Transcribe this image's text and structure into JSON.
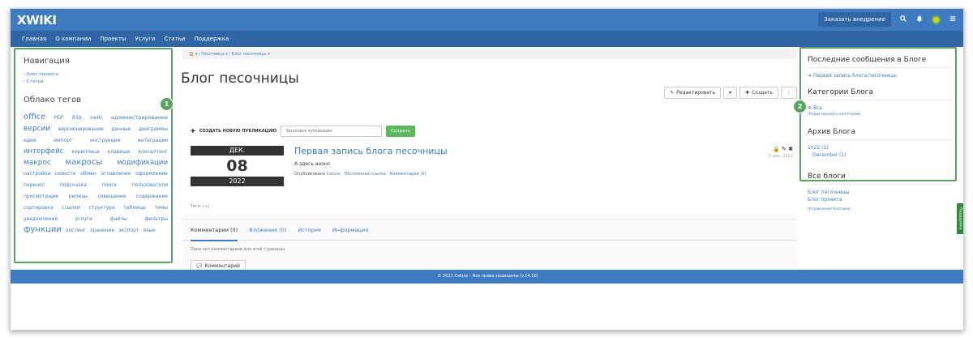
{
  "topbar": {
    "logo": "XWIKI",
    "order_button": "Заказать внедрение",
    "search_icon": "search-icon",
    "bell_icon": "bell-icon",
    "menu_icon": "menu-icon"
  },
  "menu": [
    "Главная",
    "О компании",
    "Проекты",
    "Услуги",
    "Статьи",
    "Поддержка"
  ],
  "left": {
    "nav_title": "Навигация",
    "nav_links": [
      "› Блог проекта",
      "› Статьи"
    ],
    "tags_title": "Облако тегов",
    "tags": [
      {
        "t": "office",
        "s": 10
      },
      {
        "t": "PDF",
        "s": 6
      },
      {
        "t": "RSS",
        "s": 6
      },
      {
        "t": "xwiki",
        "s": 6
      },
      {
        "t": "администрирование",
        "s": 6.5
      },
      {
        "t": "версии",
        "s": 9
      },
      {
        "t": "версионирование",
        "s": 6
      },
      {
        "t": "данные",
        "s": 6
      },
      {
        "t": "диаграммы",
        "s": 6
      },
      {
        "t": "идеи",
        "s": 6
      },
      {
        "t": "импорт",
        "s": 6
      },
      {
        "t": "инструкция",
        "s": 6
      },
      {
        "t": "интеграция",
        "s": 6
      },
      {
        "t": "интерфейс",
        "s": 8.5
      },
      {
        "t": "кириллица",
        "s": 6
      },
      {
        "t": "клавиши",
        "s": 6
      },
      {
        "t": "консалтинг",
        "s": 6
      },
      {
        "t": "макрос",
        "s": 9
      },
      {
        "t": "макросы",
        "s": 10
      },
      {
        "t": "модификации",
        "s": 8.5
      },
      {
        "t": "настройки",
        "s": 6
      },
      {
        "t": "новости",
        "s": 6
      },
      {
        "t": "обмен",
        "s": 6
      },
      {
        "t": "оглавление",
        "s": 6
      },
      {
        "t": "оформление",
        "s": 6
      },
      {
        "t": "перенос",
        "s": 6
      },
      {
        "t": "подсказка",
        "s": 6
      },
      {
        "t": "поиск",
        "s": 6
      },
      {
        "t": "пользователи",
        "s": 6
      },
      {
        "t": "просмотрщик",
        "s": 6
      },
      {
        "t": "релизы",
        "s": 6
      },
      {
        "t": "совещание",
        "s": 6
      },
      {
        "t": "содержание",
        "s": 6
      },
      {
        "t": "сортировка",
        "s": 6
      },
      {
        "t": "ссылки",
        "s": 6
      },
      {
        "t": "структура",
        "s": 6
      },
      {
        "t": "таблицы",
        "s": 6
      },
      {
        "t": "темы",
        "s": 6
      },
      {
        "t": "уведомления",
        "s": 6
      },
      {
        "t": "услуги",
        "s": 6
      },
      {
        "t": "файлы",
        "s": 6
      },
      {
        "t": "фильтры",
        "s": 6
      },
      {
        "t": "функции",
        "s": 10
      },
      {
        "t": "хостинг",
        "s": 6
      },
      {
        "t": "хранение",
        "s": 6
      },
      {
        "t": "экспорт",
        "s": 6
      },
      {
        "t": "язык",
        "s": 6
      }
    ]
  },
  "main": {
    "breadcrumb": "🏠 ▾ / Песочница ▾ / Блог песочницы ▾",
    "title": "Блог песочницы",
    "edit_label": "Редактировать",
    "create_label": "Создать",
    "new_post_label": "СОЗДАТЬ НОВУЮ ПУБЛИКАЦИЮ",
    "new_post_placeholder": "Заголовок публикации",
    "new_post_button": "Создать",
    "post": {
      "month": "ДЕК.",
      "day": "08",
      "year": "2022",
      "title": "Первая запись блога песочницы",
      "text": "А здесь анонс",
      "meta_prefix": "Опубликовано",
      "meta_author": "Coluns",
      "meta_sep1": " · ",
      "meta_link": "Постоянная ссылка",
      "meta_sep2": " · ",
      "meta_comments": "Комментарии (0)",
      "date": "8 дек. 2022"
    },
    "tags_label": "Теги: [+]",
    "tabs": [
      "Комментарии (0)",
      "Вложения (0)",
      "История",
      "Информация"
    ],
    "no_comments": "Пока нет комментариев для этой страницы",
    "comment_button": "Комментарий"
  },
  "right": {
    "recent_title": "Последние сообщения в Блоге",
    "recent_link": "Первая запись блога песочницы",
    "categories_title": "Категории Блога",
    "categories_all": "Все",
    "categories_edit": "(Редактировать категории)",
    "archive_title": "Архив Блога",
    "archive_year": "2022 (1)",
    "archive_month": "December (1)",
    "all_blogs_title": "Все блоги",
    "blog1": "Блог песочницы",
    "blog2": "Блог проекта",
    "blogs_manage": "(Управление блогами)"
  },
  "footer": "© 2022 Coluns – Все права защищены (v.14.10)",
  "side_tab": "Поддержка",
  "badges": [
    "1",
    "2"
  ],
  "colors": {
    "brand": "#3e7cbf",
    "highlight": "#5aa463",
    "create": "#5cb85c"
  }
}
